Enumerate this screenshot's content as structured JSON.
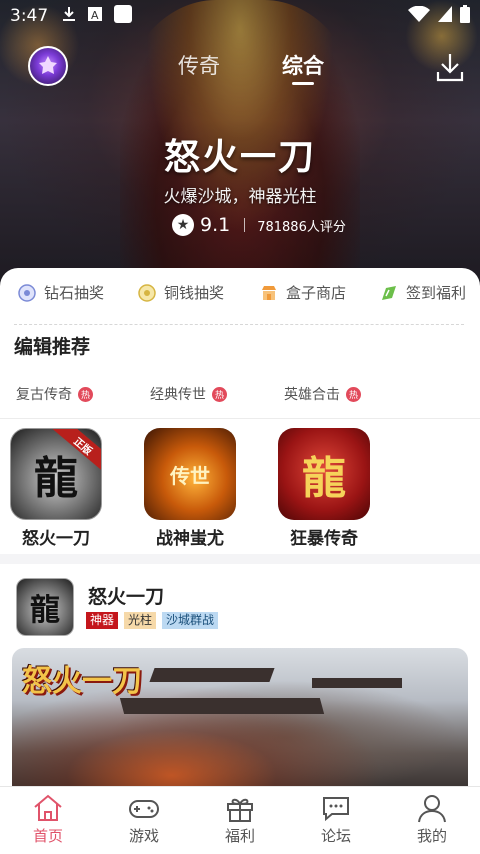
{
  "status_bar": {
    "time": "3:47",
    "icons": [
      "download-icon",
      "a-icon",
      "square-icon",
      "wifi-icon",
      "signal-icon",
      "battery-icon"
    ]
  },
  "header": {
    "tabs": [
      {
        "label": "传奇",
        "active": false
      },
      {
        "label": "综合",
        "active": true
      }
    ]
  },
  "hero": {
    "title": "怒火一刀",
    "subtitle": "火爆沙城，神器光柱",
    "score": "9.1",
    "votes": "781886人评分"
  },
  "quick_actions": [
    {
      "label": "钻石抽奖",
      "icon": "diamond-icon",
      "color": "#7b8ad6"
    },
    {
      "label": "铜钱抽奖",
      "icon": "coin-icon",
      "color": "#d6b542"
    },
    {
      "label": "盒子商店",
      "icon": "shop-icon",
      "color": "#f09a3a"
    },
    {
      "label": "签到福利",
      "icon": "sign-in-icon",
      "color": "#6cbf4a"
    }
  ],
  "section": {
    "title": "编辑推荐",
    "tabs": [
      {
        "label": "复古传奇",
        "badge": "热"
      },
      {
        "label": "经典传世",
        "badge": "热"
      },
      {
        "label": "英雄合击",
        "badge": "热"
      }
    ],
    "games": [
      {
        "name": "怒火一刀",
        "glyph": "龍",
        "ribbon": "正版"
      },
      {
        "name": "战神蚩尤",
        "glyph": "传世"
      },
      {
        "name": "狂暴传奇",
        "glyph": "龍"
      }
    ]
  },
  "feature": {
    "title": "怒火一刀",
    "glyph": "龍",
    "tags": [
      "神器",
      "光柱",
      "沙城群战"
    ],
    "banner_logo": "怒火一刀"
  },
  "bottom_nav": [
    {
      "label": "首页",
      "active": true
    },
    {
      "label": "游戏",
      "active": false
    },
    {
      "label": "福利",
      "active": false
    },
    {
      "label": "论坛",
      "active": false
    },
    {
      "label": "我的",
      "active": false
    }
  ],
  "colors": {
    "accent": "#e0536a",
    "hot_badge": "#e24a5b",
    "tag_red": "#c4161c"
  }
}
